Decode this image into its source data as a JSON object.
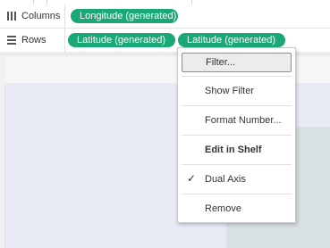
{
  "shelves": {
    "columns": {
      "label": "Columns",
      "icon": "columns-icon",
      "pills": [
        "Longitude (generated)"
      ]
    },
    "rows": {
      "label": "Rows",
      "icon": "rows-icon",
      "pills": [
        "Latitude (generated)",
        "Latitude (generated)"
      ]
    }
  },
  "pill_color": "#1aa876",
  "context_menu": {
    "items": [
      {
        "label": "Filter...",
        "highlighted": true
      },
      {
        "label": "Show Filter"
      },
      {
        "label": "Format Number..."
      },
      {
        "label": "Edit in Shelf",
        "bold": true
      },
      {
        "label": "Dual Axis",
        "checked": true,
        "check_mark": "✓"
      },
      {
        "label": "Remove"
      }
    ]
  }
}
